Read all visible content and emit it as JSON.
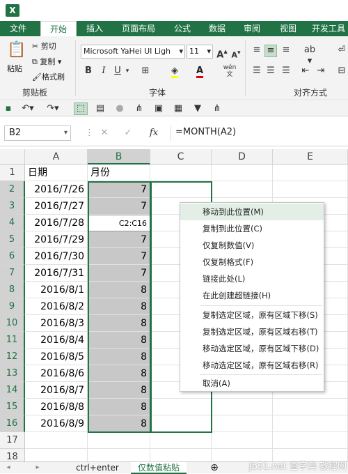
{
  "app": {
    "logo": "X"
  },
  "ribbon_tabs": [
    "文件",
    "开始",
    "插入",
    "页面布局",
    "公式",
    "数据",
    "审阅",
    "视图",
    "开发工具"
  ],
  "ribbon": {
    "paste": "粘贴",
    "cut": "剪切",
    "copy": "复制",
    "format_painter": "格式刷",
    "clipboard_group": "剪贴板",
    "font_name": "Microsoft YaHei UI Ligh",
    "font_size": "11",
    "font_group": "字体",
    "align_group": "对齐方式",
    "bold": "B",
    "italic": "I",
    "underline": "U",
    "phonetic": "wén",
    "grow": "A",
    "shrink": "A",
    "font_color_letter": "A"
  },
  "formula_bar": {
    "name_box": "B2",
    "fx": "fx",
    "formula": "=MONTH(A2)"
  },
  "columns": [
    "A",
    "B",
    "C",
    "D",
    "E"
  ],
  "rows": [
    "1",
    "2",
    "3",
    "4",
    "5",
    "6",
    "7",
    "8",
    "9",
    "10",
    "11",
    "12",
    "13",
    "14",
    "15",
    "16",
    "17",
    "18"
  ],
  "cells": {
    "A": [
      "日期",
      "2016/7/26",
      "2016/7/27",
      "2016/7/28",
      "2016/7/29",
      "2016/7/30",
      "2016/7/31",
      "2016/8/1",
      "2016/8/2",
      "2016/8/3",
      "2016/8/4",
      "2016/8/5",
      "2016/8/6",
      "2016/8/7",
      "2016/8/8",
      "2016/8/9"
    ],
    "B": [
      "月份",
      "7",
      "7",
      "C2:C16",
      "7",
      "7",
      "7",
      "8",
      "8",
      "8",
      "8",
      "8",
      "8",
      "8",
      "8",
      "8"
    ]
  },
  "drag_tooltip": "C2:C16",
  "context_menu": [
    "移动到此位置(M)",
    "复制到此位置(C)",
    "仅复制数值(V)",
    "仅复制格式(F)",
    "链接此处(L)",
    "在此创建超链接(H)",
    "复制选定区域，原有区域下移(S)",
    "复制选定区域，原有区域右移(T)",
    "移动选定区域，原有区域下移(D)",
    "移动选定区域，原有区域右移(R)",
    "取消(A)"
  ],
  "sheet_tabs": [
    "ctrl+enter",
    "仅数值粘贴"
  ],
  "add_sheet": "⊕",
  "watermark": "jb51.net 查字典 教程网",
  "colors": {
    "accent": "#217346",
    "selection": "#c8c8c8"
  }
}
